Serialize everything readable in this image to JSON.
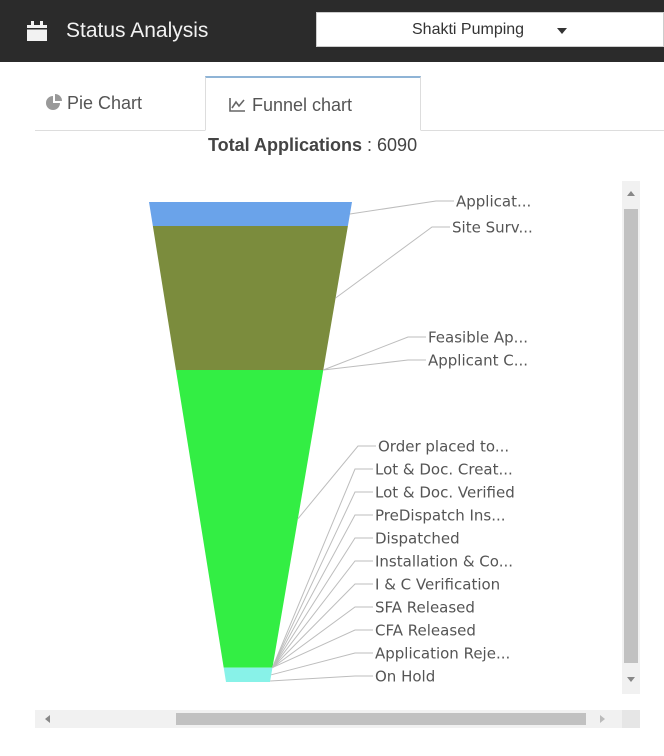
{
  "header": {
    "title": "Status Analysis",
    "icon": "calendar-icon",
    "dropdown_value": "Shakti Pumping"
  },
  "tabs": [
    {
      "label": "Pie Chart",
      "icon": "pie-chart-icon",
      "active": false
    },
    {
      "label": "Funnel chart",
      "icon": "line-chart-icon",
      "active": true
    }
  ],
  "total": {
    "label": "Total Applications",
    "separator": " : ",
    "value": "6090"
  },
  "chart_data": {
    "type": "funnel",
    "stages": [
      {
        "label": "Applicat...",
        "share": 0.05,
        "color": "#6aa3ea"
      },
      {
        "label": "Site Surv...",
        "share": 0.3,
        "color": "#7b8c3d"
      },
      {
        "label": "Feasible Ap...",
        "share": 0.0,
        "color": "#7b8c3d"
      },
      {
        "label": "Applicant C...",
        "share": 0.0,
        "color": "#7b8c3d"
      },
      {
        "label": "Order placed to...",
        "share": 0.62,
        "color": "#33ee44"
      },
      {
        "label": "Lot & Doc. Creat...",
        "share": 0.0,
        "color": "#33ee44"
      },
      {
        "label": "Lot & Doc. Verified",
        "share": 0.0,
        "color": "#33ee44"
      },
      {
        "label": "PreDispatch Ins...",
        "share": 0.0,
        "color": "#33ee44"
      },
      {
        "label": "Dispatched",
        "share": 0.0,
        "color": "#33ee44"
      },
      {
        "label": "Installation & Co...",
        "share": 0.0,
        "color": "#33ee44"
      },
      {
        "label": "I & C Verification",
        "share": 0.0,
        "color": "#33ee44"
      },
      {
        "label": "SFA Released",
        "share": 0.0,
        "color": "#33ee44"
      },
      {
        "label": "CFA Released",
        "share": 0.0,
        "color": "#33ee44"
      },
      {
        "label": "Application Reje...",
        "share": 0.03,
        "color": "#88f2e8"
      },
      {
        "label": "On Hold",
        "share": 0.0,
        "color": "#88f2e8"
      }
    ]
  }
}
